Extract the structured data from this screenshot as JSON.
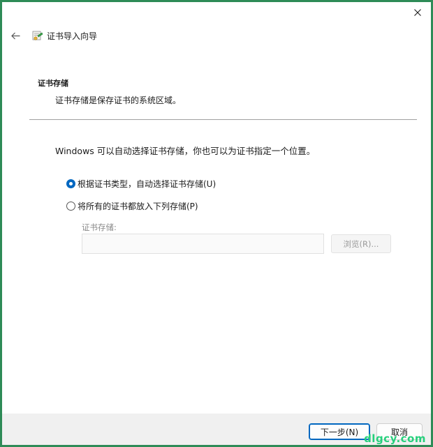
{
  "window": {
    "wizard_title": "证书导入向导"
  },
  "section": {
    "title": "证书存储",
    "description": "证书存储是保存证书的系统区域。"
  },
  "intro_text": "Windows 可以自动选择证书存储，你也可以为证书指定一个位置。",
  "options": [
    {
      "label": "根据证书类型，自动选择证书存储(U)",
      "selected": true
    },
    {
      "label": "将所有的证书都放入下列存储(P)",
      "selected": false
    }
  ],
  "store": {
    "label": "证书存储:",
    "value": "",
    "browse_label": "浏览(R)..."
  },
  "footer": {
    "next_label": "下一步(N)",
    "cancel_label": "取消"
  },
  "watermark": "dlgcy.com",
  "colors": {
    "accent": "#0067c0",
    "frame": "#2e8b57",
    "watermark": "#26d07c"
  },
  "icons": [
    "close-icon",
    "back-arrow-icon",
    "certificate-icon"
  ]
}
